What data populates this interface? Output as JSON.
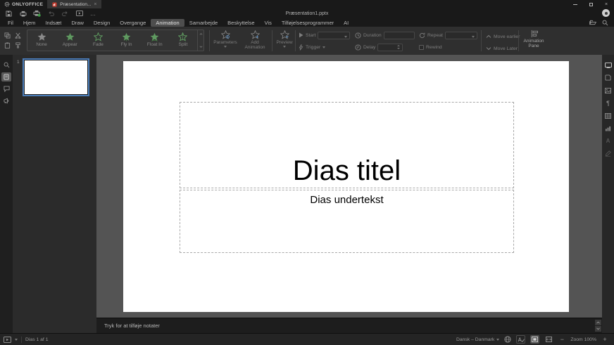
{
  "app": {
    "brand": "ONLYOFFICE",
    "doc_tab": "Præsentation...",
    "doc_tab_close": "×",
    "doc_title": "Præsentation1.pptx",
    "window_close": "×",
    "more_label": "…"
  },
  "menu": {
    "items": [
      {
        "label": "Fil"
      },
      {
        "label": "Hjem"
      },
      {
        "label": "Indsæt"
      },
      {
        "label": "Draw"
      },
      {
        "label": "Design"
      },
      {
        "label": "Overgange"
      },
      {
        "label": "Animation",
        "active": true
      },
      {
        "label": "Samarbejde"
      },
      {
        "label": "Beskyttelse"
      },
      {
        "label": "Vis"
      },
      {
        "label": "Tilføjelsesprogrammer"
      },
      {
        "label": "AI"
      }
    ]
  },
  "ribbon": {
    "gallery": [
      {
        "label": "None",
        "style": "gray"
      },
      {
        "label": "Appear",
        "style": "filled"
      },
      {
        "label": "Fade",
        "style": "outline"
      },
      {
        "label": "Fly In",
        "style": "filled"
      },
      {
        "label": "Float In",
        "style": "filled"
      },
      {
        "label": "Split",
        "style": "outline"
      }
    ],
    "parameters_label": "Parameters",
    "add_animation_label": "Add Animation",
    "preview_label": "Preview",
    "start_label": "Start",
    "trigger_label": "Trigger",
    "duration_label": "Duration",
    "delay_label": "Delay",
    "repeat_label": "Repeat",
    "rewind_label": "Rewind",
    "move_earlier_label": "Move earlier",
    "move_later_label": "Move Later",
    "animation_pane_label": "Animation Pane"
  },
  "slides_panel": {
    "slide_number": "1"
  },
  "slide": {
    "title": "Dias titel",
    "subtitle": "Dias undertekst"
  },
  "notes": {
    "placeholder": "Tryk for at tilføje notater"
  },
  "status_bar": {
    "slide_counter": "Dias 1 af 1",
    "language": "Dansk – Danmark",
    "zoom": "Zoom 100%",
    "zoom_out": "−",
    "zoom_in": "+"
  },
  "colors": {
    "accent_blue": "#4a7cb8",
    "star_green": "#5f9a60",
    "doc_icon_red": "#c43b2e",
    "canvas_gray": "#545454"
  }
}
